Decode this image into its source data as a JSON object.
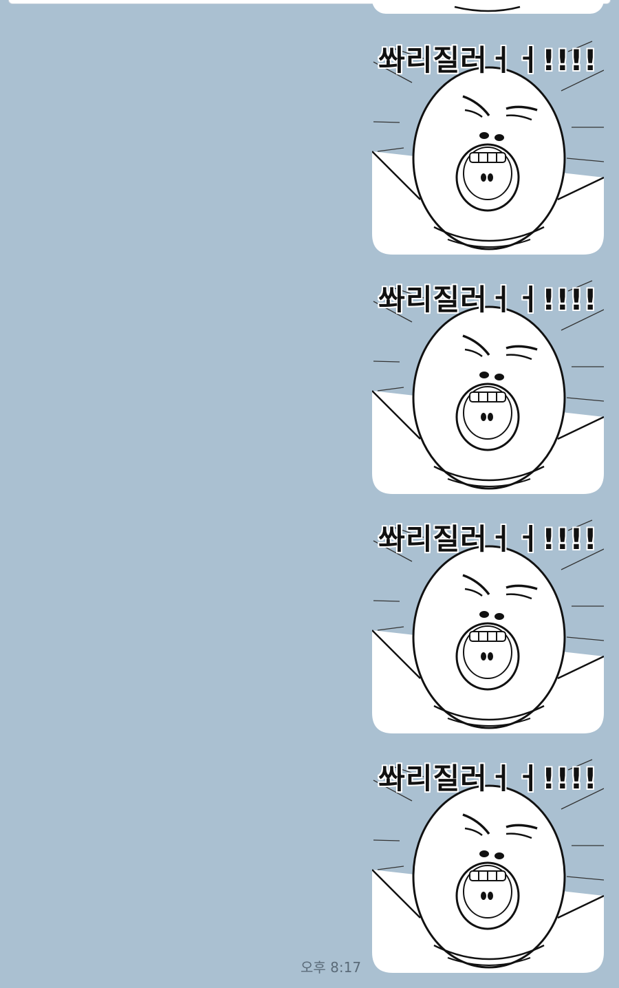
{
  "chat": {
    "background": "#aac0d1",
    "messages": [
      {
        "type": "sticker",
        "caption": "쏴리질러ㅓㅓ!!!!",
        "icon": "screaming-face-sticker"
      },
      {
        "type": "sticker",
        "caption": "쏴리질러ㅓㅓ!!!!",
        "icon": "screaming-face-sticker"
      },
      {
        "type": "sticker",
        "caption": "쏴리질러ㅓㅓ!!!!",
        "icon": "screaming-face-sticker"
      },
      {
        "type": "sticker",
        "caption": "쏴리질러ㅓㅓ!!!!",
        "icon": "screaming-face-sticker"
      }
    ],
    "timestamp": "오후 8:17"
  }
}
